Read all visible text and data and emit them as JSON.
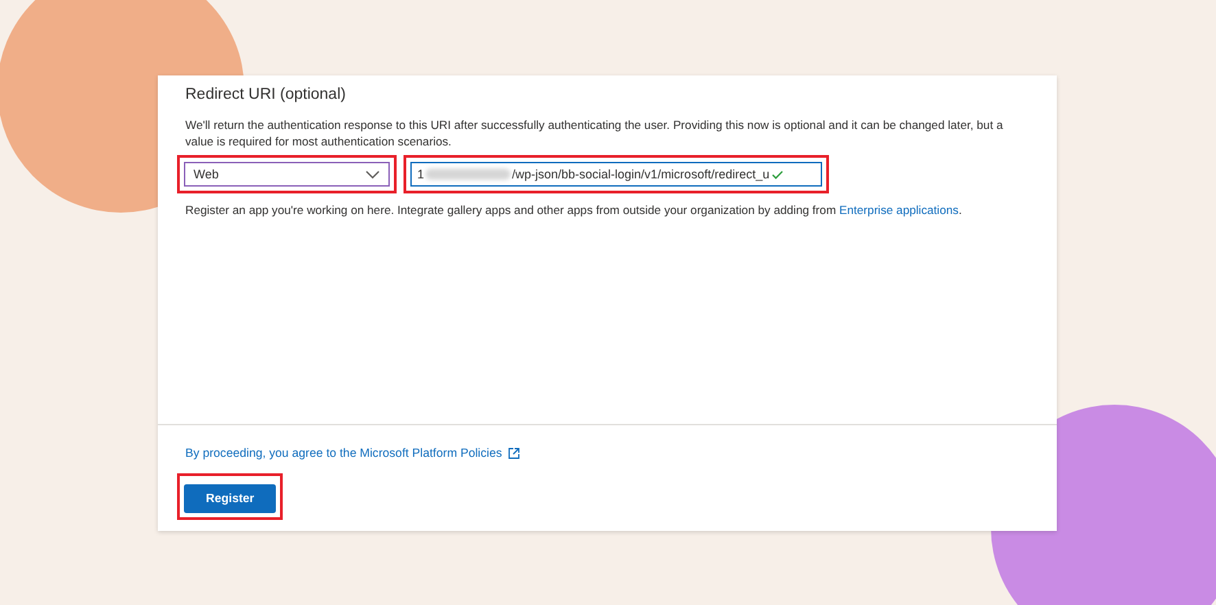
{
  "section": {
    "title": "Redirect URI (optional)",
    "description": "We'll return the authentication response to this URI after successfully authenticating the user. Providing this now is optional and it can be changed later, but a value is required for most authentication scenarios.",
    "platform_select": {
      "value": "Web",
      "highlighted": true
    },
    "uri_field": {
      "prefix": "1",
      "value": "/wp-json/bb-social-login/v1/microsoft/redirect_u",
      "redacted": true,
      "valid": true,
      "highlighted": true
    },
    "helper_text": "Register an app you're working on here. Integrate gallery apps and other apps from outside your organization by adding from",
    "helper_link": "Enterprise applications",
    "helper_end": "."
  },
  "footer": {
    "policy_link": "By proceeding, you agree to the Microsoft Platform Policies",
    "register_button": {
      "label": "Register",
      "highlighted": true
    }
  }
}
